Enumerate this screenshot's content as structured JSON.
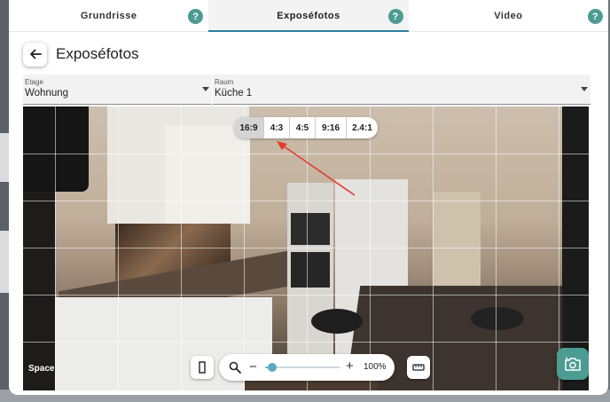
{
  "tabs": [
    {
      "label": "Grundrisse",
      "active": false
    },
    {
      "label": "Exposéfotos",
      "active": true
    },
    {
      "label": "Video",
      "active": false
    }
  ],
  "help_glyph": "?",
  "header": {
    "title": "Exposéfotos",
    "back_icon": "arrow-left-icon"
  },
  "filters": {
    "etage": {
      "label": "Etage",
      "value": "Wohnung"
    },
    "raum": {
      "label": "Raum",
      "value": "Küche 1"
    }
  },
  "aspect_ratios": {
    "options": [
      "16:9",
      "4:3",
      "4:5",
      "9:16",
      "2.4:1"
    ],
    "selected": "16:9"
  },
  "photo": {
    "space_label": "Space"
  },
  "zoom": {
    "minus": "−",
    "plus": "+",
    "percent_label": "100%",
    "level": 0.1
  },
  "colors": {
    "accent": "#4d9c93",
    "tab_underline": "#2c7da0",
    "annotation_arrow": "#e23b2e"
  },
  "icons": {
    "portrait_toggle": "portrait-frame-icon",
    "zoom": "search-icon",
    "ruler": "ruler-icon",
    "camera": "camera-rotate-icon"
  }
}
